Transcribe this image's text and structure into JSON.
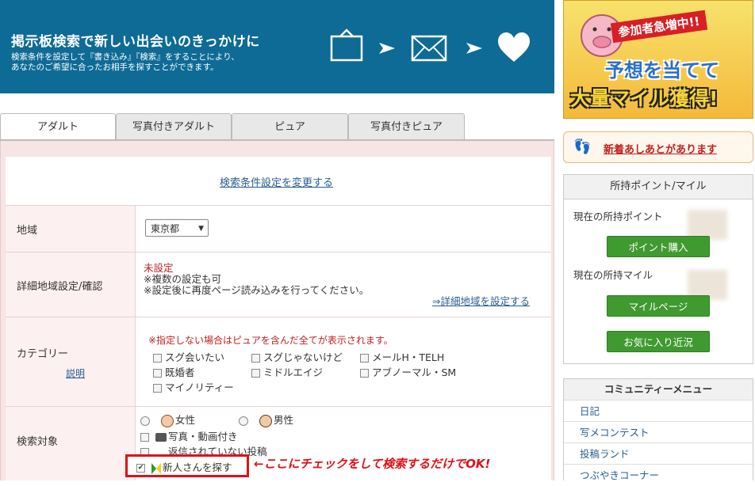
{
  "hero": {
    "title": "掲示板検索で新しい出会いのきっかけに",
    "desc_line1": "検索条件を設定して『書き込み』『検索』をすることにより、",
    "desc_line2": "あなたのご希望に合ったお相手を探すことができます。"
  },
  "tabs": [
    "アダルト",
    "写真付きアダルト",
    "ピュア",
    "写真付きピュア"
  ],
  "search": {
    "change_conditions_link": "検索条件設定を変更する",
    "region_label": "地域",
    "region_value": "東京都",
    "detail_region_label": "詳細地域設定/確認",
    "detail_unset": "未設定",
    "detail_note1": "※複数の設定も可",
    "detail_note2": "※設定後に再度ページ読み込みを行ってください。",
    "detail_set_link": "⇒詳細地域を設定する",
    "category_label": "カテゴリー",
    "category_help": "説明",
    "category_note": "※指定しない場合はピュアを含んだ全てが表示されます。",
    "categories": [
      "スグ会いたい",
      "スグじゃないけど",
      "メールH・TELH",
      "既婚者",
      "ミドルエイジ",
      "アブノーマル・SM",
      "マイノリティー"
    ],
    "target_label": "検索対象",
    "gender_female": "女性",
    "gender_male": "男性",
    "with_photo": "写真・動画付き",
    "not_replied": "返信されていない投稿",
    "newcomer": "新人さんを探す",
    "annotation": "←ここにチェックをして検索するだけでOK!"
  },
  "ad": {
    "badge": "参加者急増中!!",
    "line1": "予想を当てて",
    "line2": "大量マイル獲得!"
  },
  "footprint": {
    "text": "新着あしあとがあります"
  },
  "points": {
    "header": "所持ポイント/マイル",
    "current_points": "現在の所持ポイント",
    "buy_points": "ポイント購入",
    "current_miles": "現在の所持マイル",
    "miles_page": "マイルページ",
    "favorites": "お気に入り近況"
  },
  "community": {
    "header": "コミュニティーメニュー",
    "items": [
      "日記",
      "写メコンテスト",
      "投稿ランド",
      "つぶやきコーナー"
    ]
  },
  "colors": {
    "header_blue": "#0e6b96",
    "green_button": "#3f9a2f",
    "footprint_red": "#c0201e",
    "highlight_red": "#e0101a"
  }
}
